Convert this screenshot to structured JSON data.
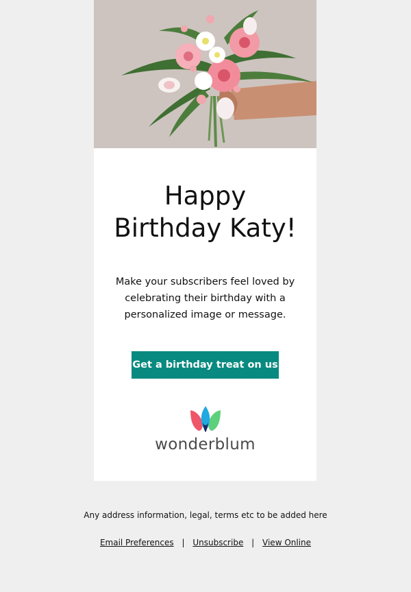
{
  "hero": {
    "image_subject": "bouquet-of-pink-and-white-flowers",
    "background_color": "#cfc7c2"
  },
  "headline": {
    "line1": "Happy",
    "line2": "Birthday Katy!"
  },
  "body": {
    "line1": "Make your subscribers feel loved by",
    "line2": "celebrating their birthday with a",
    "line3": "personalized image or message."
  },
  "cta": {
    "label": "Get a birthday treat on us",
    "color": "#098a80"
  },
  "logo": {
    "wordmark": "wonderblum",
    "icon": "tulip-logo-icon",
    "colors": [
      "#f0566a",
      "#21a9e0",
      "#5cd07a"
    ]
  },
  "footer": {
    "legal": "Any address information, legal, terms etc to be added here",
    "links": [
      {
        "label": "Email Preferences"
      },
      {
        "label": "Unsubscribe"
      },
      {
        "label": "View Online"
      }
    ],
    "separator": "|"
  }
}
